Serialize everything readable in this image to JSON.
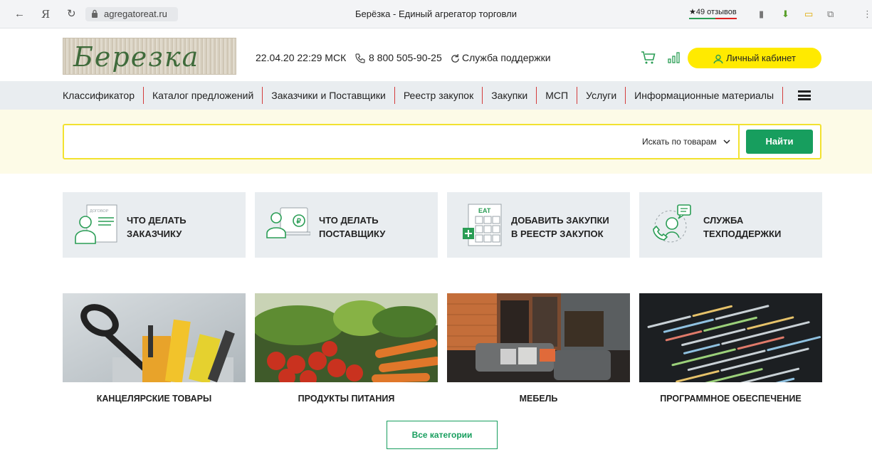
{
  "browser": {
    "back_icon": "back-arrow-icon",
    "url": "agregatoreat.ru",
    "title": "Берёзка - Единый агрегатор торговли",
    "reviews": "★49 отзывов"
  },
  "header": {
    "logo_text": "Березка",
    "datetime": "22.04.20 22:29 МСК",
    "phone": "8 800 505-90-25",
    "support": "Служба поддержки",
    "cabinet": "Личный кабинет"
  },
  "nav": {
    "items": [
      "Классификатор",
      "Каталог предложений",
      "Заказчики и Поставщики",
      "Реестр закупок",
      "Закупки",
      "МСП",
      "Услуги",
      "Информационные материалы"
    ]
  },
  "search": {
    "placeholder": "",
    "select": "Искать по товарам",
    "button": "Найти"
  },
  "tiles": [
    {
      "line1": "ЧТО ДЕЛАТЬ",
      "line2": "ЗАКАЗЧИКУ",
      "icon": "document-person-icon",
      "icon_text": "ДОГОВОР"
    },
    {
      "line1": "ЧТО ДЕЛАТЬ",
      "line2": "ПОСТАВЩИКУ",
      "icon": "supplier-coin-icon"
    },
    {
      "line1": "ДОБАВИТЬ ЗАКУПКИ",
      "line2": "В РЕЕСТР ЗАКУПОК",
      "icon": "calendar-add-icon",
      "icon_text": "EAT"
    },
    {
      "line1": "СЛУЖБА",
      "line2": "ТЕХПОДДЕРЖКИ",
      "icon": "support-operator-icon"
    }
  ],
  "categories": [
    {
      "label": "КАНЦЕЛЯРСКИЕ ТОВАРЫ"
    },
    {
      "label": "ПРОДУКТЫ ПИТАНИЯ"
    },
    {
      "label": "МЕБЕЛЬ"
    },
    {
      "label": "ПРОГРАММНОЕ ОБЕСПЕЧЕНИЕ"
    }
  ],
  "all_categories": "Все категории",
  "colors": {
    "accent_green": "#179e5e",
    "accent_yellow": "#ffea00",
    "nav_bg": "#e9edf0",
    "divider_red": "#d43c3c"
  }
}
